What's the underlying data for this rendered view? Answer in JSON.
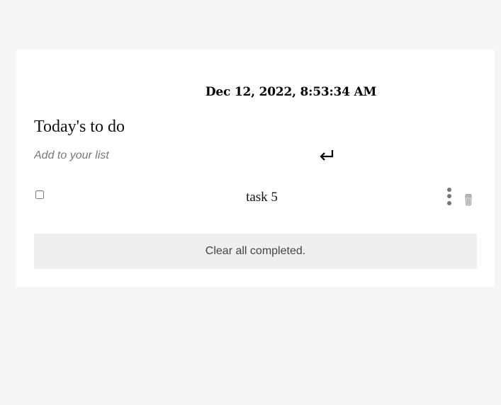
{
  "header": {
    "datetime": "Dec 12, 2022, 8:53:34 AM",
    "title": "Today's to do"
  },
  "add_task": {
    "placeholder": "Add to your list",
    "value": "",
    "submit_icon": "enter-return-icon"
  },
  "tasks": [
    {
      "label": "task 5",
      "completed": false,
      "menu_icon": "vertical-ellipsis-icon",
      "delete_icon": "trash-icon"
    }
  ],
  "footer": {
    "clear_label": "Clear all completed."
  },
  "colors": {
    "page_background": "#f5f5f5",
    "card_background": "#ffffff",
    "clear_button_background": "#efefef",
    "muted_text": "#777777"
  }
}
